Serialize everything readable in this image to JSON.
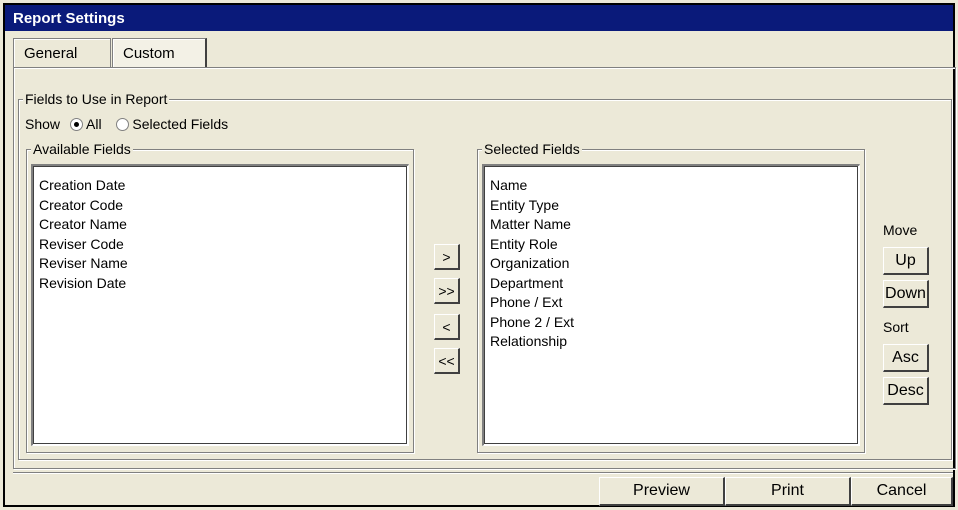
{
  "window": {
    "title": "Report Settings"
  },
  "tabs": [
    {
      "label": "General",
      "active": false
    },
    {
      "label": "Custom",
      "active": true
    }
  ],
  "fields_group": {
    "legend": "Fields to Use in Report",
    "show_label": "Show",
    "show_options": [
      {
        "label": "All",
        "checked": true
      },
      {
        "label": "Selected Fields",
        "checked": false
      }
    ]
  },
  "available": {
    "legend": "Available Fields",
    "items": [
      "Creation Date",
      "Creator Code",
      "Creator Name",
      "Reviser Code",
      "Reviser Name",
      "Revision Date"
    ]
  },
  "selected": {
    "legend": "Selected Fields",
    "items": [
      "Name",
      "Entity Type",
      "Matter Name",
      "Entity Role",
      "Organization",
      "Department",
      "Phone / Ext",
      "Phone 2 / Ext",
      "Relationship"
    ]
  },
  "transfer": {
    "add": ">",
    "add_all": ">>",
    "remove": "<",
    "remove_all": "<<"
  },
  "move": {
    "label": "Move",
    "up": "Up",
    "down": "Down"
  },
  "sort": {
    "label": "Sort",
    "asc": "Asc",
    "desc": "Desc"
  },
  "footer": {
    "preview": "Preview",
    "print": "Print",
    "cancel": "Cancel"
  },
  "colors": {
    "titlebar": "#0a1a7a",
    "face": "#ece9d8"
  }
}
